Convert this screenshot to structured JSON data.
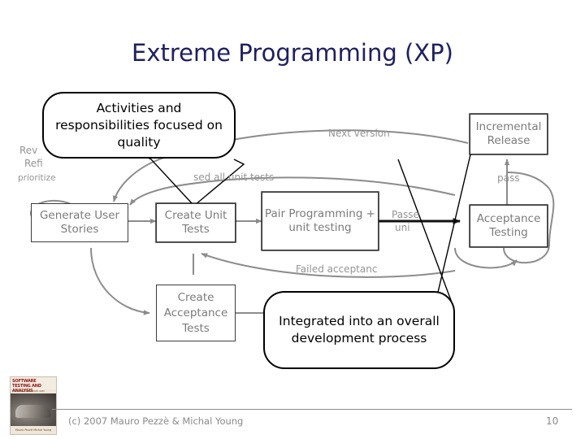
{
  "slide": {
    "title": "Extreme Programming (XP)",
    "title_color": "#1f2060",
    "page_number": "10"
  },
  "callouts": [
    {
      "id": "quality-callout",
      "text": "Activities and responsibilities focused on quality"
    },
    {
      "id": "integration-callout",
      "text": "Integrated into an overall development process"
    }
  ],
  "diagram": {
    "boxes": [
      {
        "id": "generate-user-stories",
        "label": "Generate User Stories"
      },
      {
        "id": "create-unit-tests",
        "label": "Create Unit Tests"
      },
      {
        "id": "pair-programming",
        "label": "Pair Programming + unit testing"
      },
      {
        "id": "acceptance-testing",
        "label": "Acceptance Testing"
      },
      {
        "id": "incremental-release",
        "label": "Incremental Release"
      },
      {
        "id": "create-acceptance-tests",
        "label": "Create Acceptance Tests"
      }
    ],
    "edge_labels": [
      {
        "id": "review-label",
        "text": "Rev"
      },
      {
        "id": "refine-label",
        "text": "Refi"
      },
      {
        "id": "prioritize-label",
        "text": "prioritize"
      },
      {
        "id": "passed-all-unit-tests-label",
        "text": "sed all unit tests"
      },
      {
        "id": "next-version-label",
        "text": "Next version"
      },
      {
        "id": "pass-label",
        "text": "pass"
      },
      {
        "id": "passed-unit-line1-label",
        "text": "Passe"
      },
      {
        "id": "passed-unit-line2-label",
        "text": "uni"
      },
      {
        "id": "failed-acceptance-label",
        "text": "Failed acceptanc"
      }
    ],
    "colors": {
      "box_border": "#3c3c3c",
      "box_text": "#7b7b7b",
      "connector": "#8c8c8c",
      "connector_strong": "#000000",
      "label_text": "#949494"
    }
  },
  "footer": {
    "copyright": "(c) 2007 Mauro Pezzè & Michal Young",
    "book": {
      "title": "SOFTWARE TESTING AND ANALYSIS",
      "subtitle": "PROCESS PRINCIPLES AND TECHNIQUES",
      "authors": "Mauro Pezzè Michal Young"
    }
  }
}
